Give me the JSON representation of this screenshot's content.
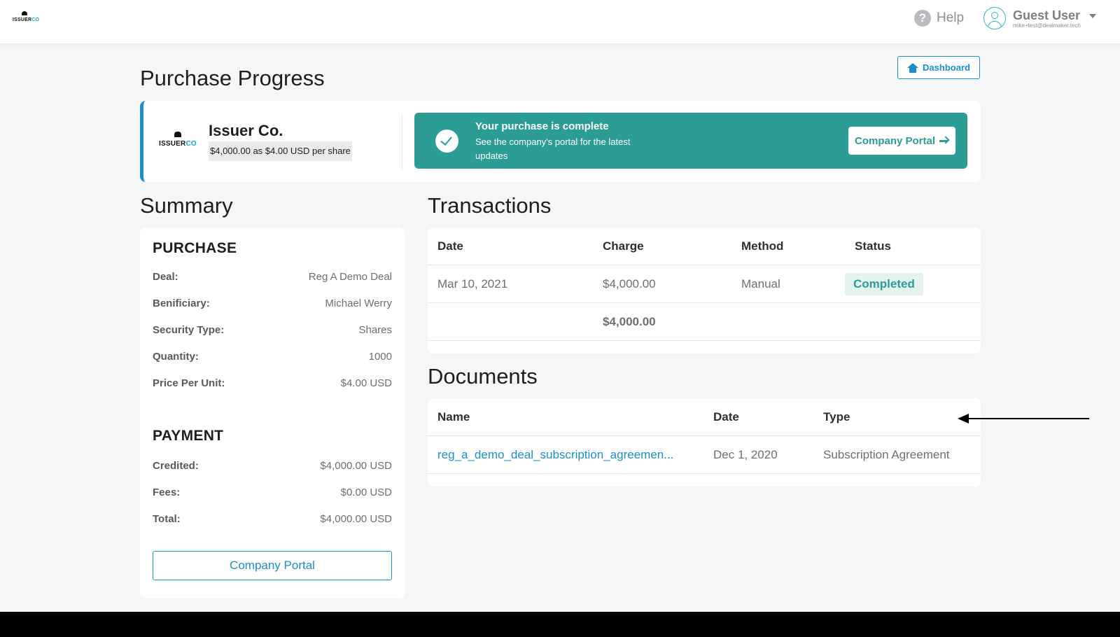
{
  "header": {
    "brand": {
      "name_main": "ISSUER",
      "name_accent": "CO"
    },
    "help_label": "Help",
    "user": {
      "name": "Guest User",
      "email": "mike+test@dealmaker.tech"
    }
  },
  "page": {
    "title": "Purchase Progress",
    "dashboard_label": "Dashboard"
  },
  "issuer": {
    "logo": {
      "name_main": "ISSUER",
      "name_accent": "CO"
    },
    "name": "Issuer Co.",
    "price_line": "$4,000.00 as $4.00 USD per share"
  },
  "banner": {
    "title": "Your purchase is complete",
    "subtitle": "See the company's portal for the latest updates",
    "button_label": "Company Portal"
  },
  "summary": {
    "title": "Summary",
    "purchase_heading": "PURCHASE",
    "purchase_rows": [
      {
        "label": "Deal:",
        "value": "Reg A Demo Deal"
      },
      {
        "label": "Benificiary:",
        "value": "Michael Werry"
      },
      {
        "label": "Security Type:",
        "value": "Shares"
      },
      {
        "label": "Quantity:",
        "value": "1000"
      },
      {
        "label": "Price Per Unit:",
        "value": "$4.00 USD"
      }
    ],
    "payment_heading": "PAYMENT",
    "payment_rows": [
      {
        "label": "Credited:",
        "value": "$4,000.00 USD"
      },
      {
        "label": "Fees:",
        "value": "$0.00 USD"
      },
      {
        "label": "Total:",
        "value": "$4,000.00 USD"
      }
    ],
    "portal_button_label": "Company Portal"
  },
  "transactions": {
    "title": "Transactions",
    "columns": [
      "Date",
      "Charge",
      "Method",
      "Status"
    ],
    "rows": [
      {
        "date": "Mar 10, 2021",
        "charge": "$4,000.00",
        "method": "Manual",
        "status": "Completed"
      }
    ],
    "total": "$4,000.00"
  },
  "documents": {
    "title": "Documents",
    "columns": [
      "Name",
      "Date",
      "Type"
    ],
    "rows": [
      {
        "name": "reg_a_demo_deal_subscription_agreemen...",
        "date": "Dec 1, 2020",
        "type": "Subscription Agreement"
      }
    ]
  },
  "colors": {
    "accent": "#1a8fc9",
    "success": "#2b9d94",
    "background": "#f5f6f8"
  }
}
